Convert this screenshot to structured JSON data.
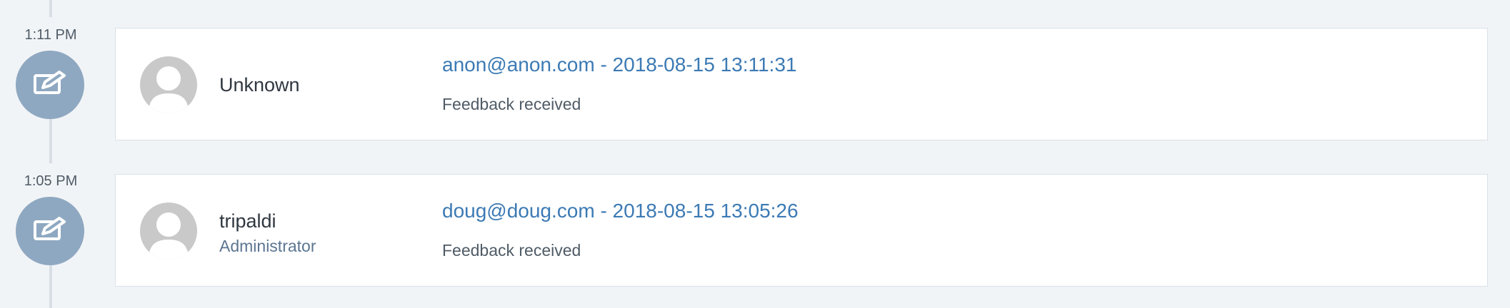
{
  "timeline": {
    "entries": [
      {
        "time": "1:11 PM",
        "icon": "edit-icon",
        "user": {
          "name": "Unknown",
          "role": ""
        },
        "title": "anon@anon.com - 2018-08-15 13:11:31",
        "description": "Feedback received"
      },
      {
        "time": "1:05 PM",
        "icon": "edit-icon",
        "user": {
          "name": "tripaldi",
          "role": "Administrator"
        },
        "title": "doug@doug.com - 2018-08-15 13:05:26",
        "description": "Feedback received"
      }
    ]
  }
}
